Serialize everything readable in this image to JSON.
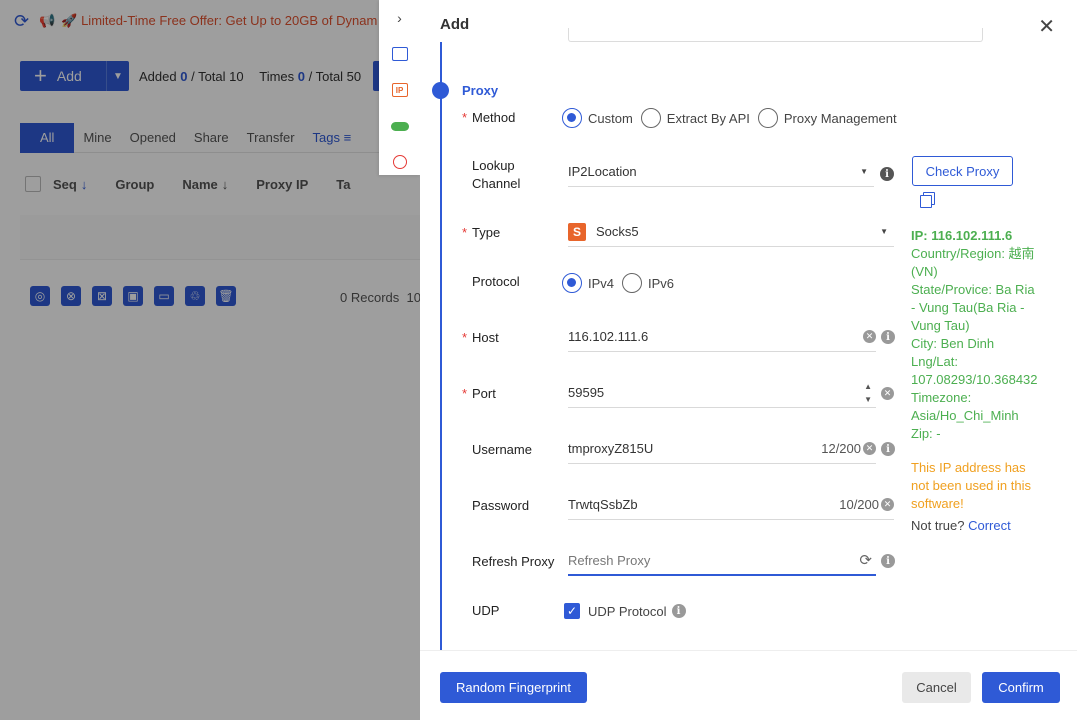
{
  "background": {
    "banner": {
      "icon": "megaphone-icon",
      "text": "🚀 Limited-Time Free Offer: Get Up to 20GB of Dynam"
    },
    "toolbar": {
      "add_label": "Add",
      "added_label": "Added",
      "added_value": "0",
      "added_total": "/ Total 10",
      "times_label": "Times",
      "times_value": "0",
      "times_total": "/ Total 50"
    },
    "tabs": [
      "All",
      "Mine",
      "Opened",
      "Share",
      "Transfer",
      "Tags"
    ],
    "columns": [
      "Seq",
      "Group",
      "Name",
      "Proxy IP",
      "Ta"
    ],
    "records": "0 Records",
    "records_suffix": "10"
  },
  "drawer": {
    "title": "Add",
    "section": "Proxy",
    "method": {
      "label": "Method",
      "options": [
        "Custom",
        "Extract By API",
        "Proxy Management"
      ],
      "selected": "Custom"
    },
    "lookup": {
      "label_line1": "Lookup",
      "label_line2": "Channel",
      "value": "IP2Location"
    },
    "check_proxy_label": "Check Proxy",
    "type": {
      "label": "Type",
      "logo": "S",
      "value": "Socks5"
    },
    "protocol": {
      "label": "Protocol",
      "options": [
        "IPv4",
        "IPv6"
      ],
      "selected": "IPv4"
    },
    "host": {
      "label": "Host",
      "value": "116.102.111.6"
    },
    "port": {
      "label": "Port",
      "value": "59595"
    },
    "username": {
      "label": "Username",
      "value": "tmproxyZ815U",
      "counter": "12/200"
    },
    "password": {
      "label": "Password",
      "value": "TrwtqSsbZb",
      "counter": "10/200"
    },
    "refresh": {
      "label": "Refresh Proxy",
      "placeholder": "Refresh Proxy"
    },
    "udp": {
      "label": "UDP",
      "option": "UDP Protocol",
      "checked": true
    },
    "ip_info": {
      "ip": "IP:  116.102.111.6",
      "country": "Country/Region:  越南 (VN)",
      "state": "State/Provice:   Ba Ria - Vung Tau(Ba Ria - Vung Tau)",
      "city": "City: Ben Dinh",
      "lnglat_label": "Lng/Lat:",
      "lnglat": " 107.08293/10.368432",
      "timezone_label": "Timezone:",
      "timezone": " Asia/Ho_Chi_Minh",
      "zip": "Zip:  -"
    },
    "warning": "This IP address has not been used in this software!",
    "not_true": "Not true?",
    "correct_link": "Correct",
    "footer": {
      "random_fingerprint": "Random Fingerprint",
      "cancel": "Cancel",
      "confirm": "Confirm"
    }
  },
  "colors": {
    "primary": "#2f5ad6",
    "success": "#4caf50",
    "warning": "#f0a020",
    "required": "#e53935"
  }
}
